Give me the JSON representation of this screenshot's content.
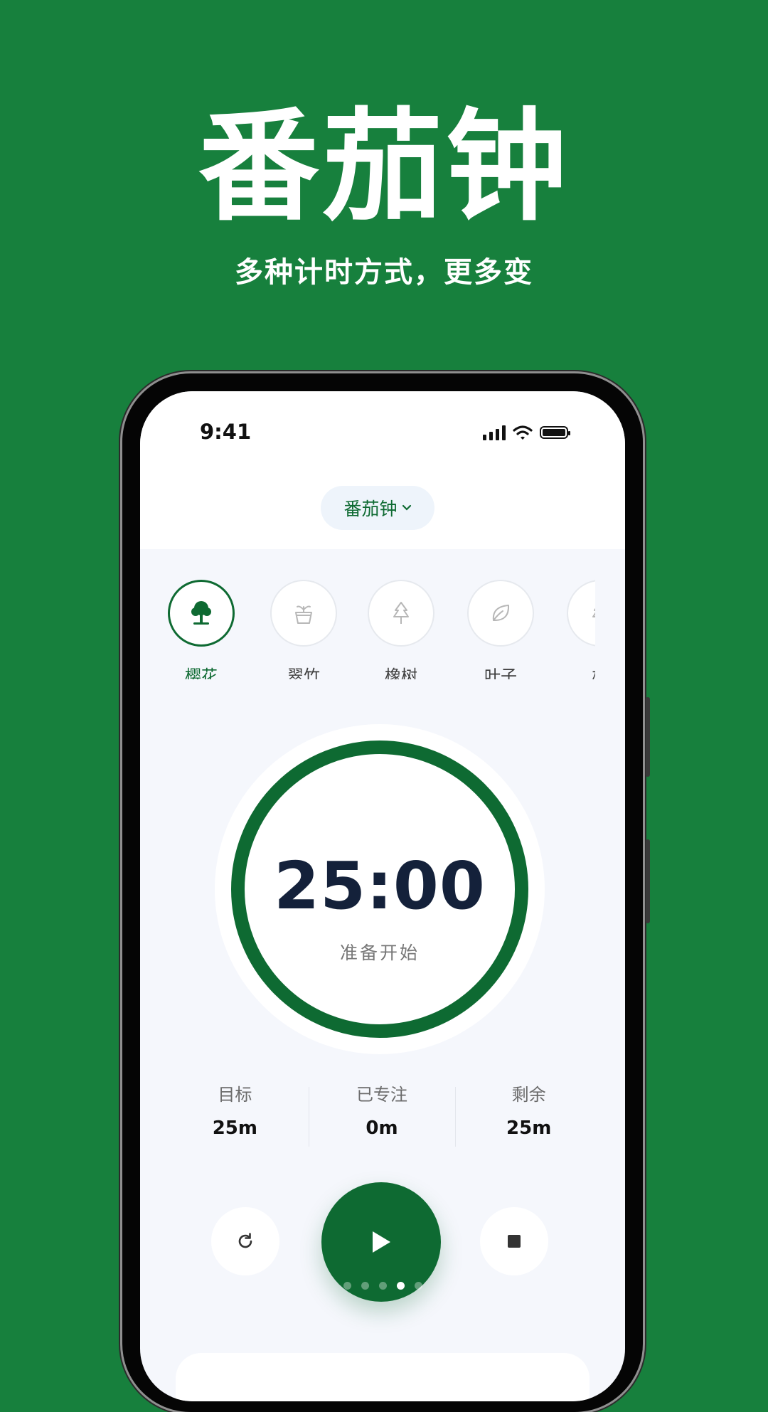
{
  "hero": {
    "title": "番茄钟",
    "subtitle": "多种计时方式，更多变"
  },
  "status_bar": {
    "time": "9:41",
    "icons": [
      "signal-icon",
      "wifi-icon",
      "battery-icon"
    ]
  },
  "mode_selector": {
    "label": "番茄钟",
    "icon": "chevron-down-icon"
  },
  "trees": [
    {
      "label": "樱花",
      "icon": "tree-icon",
      "selected": true
    },
    {
      "label": "翠竹",
      "icon": "potted-plant-icon",
      "selected": false
    },
    {
      "label": "橡树",
      "icon": "pine-tree-icon",
      "selected": false
    },
    {
      "label": "叶子",
      "icon": "leaf-icon",
      "selected": false
    },
    {
      "label": "松",
      "icon": "tree-icon",
      "selected": false
    }
  ],
  "timer": {
    "value": "25:00",
    "status": "准备开始",
    "progress": 1.0
  },
  "stats": [
    {
      "label": "目标",
      "value": "25m"
    },
    {
      "label": "已专注",
      "value": "0m"
    },
    {
      "label": "剩余",
      "value": "25m"
    }
  ],
  "controls": {
    "reset_icon": "refresh-icon",
    "play_icon": "play-icon",
    "stop_icon": "stop-icon"
  },
  "pager": {
    "count": 5,
    "active_index": 3
  },
  "colors": {
    "brand_green": "#17803d",
    "accent_green": "#0e6a32",
    "timer_text": "#14213a"
  }
}
